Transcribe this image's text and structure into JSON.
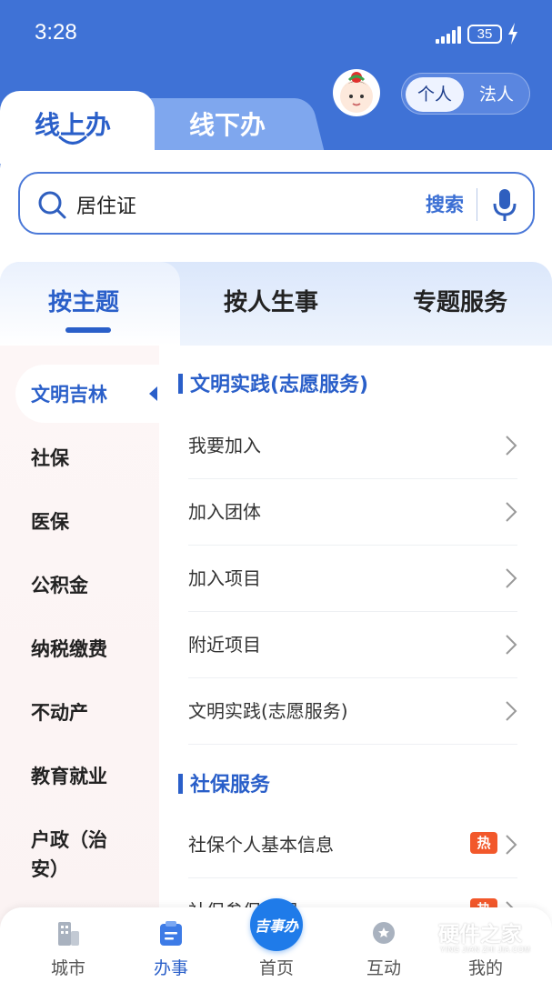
{
  "status_bar": {
    "time": "3:28",
    "battery": "35"
  },
  "header": {
    "identity_switch": {
      "selected": "个人",
      "other": "法人"
    },
    "channel_tabs": {
      "online": "线上办",
      "offline": "线下办"
    }
  },
  "search": {
    "value": "居住证",
    "button": "搜索"
  },
  "category_tabs": [
    "按主题",
    "按人生事",
    "专题服务"
  ],
  "sidebar": {
    "items": [
      {
        "label": "文明吉林"
      },
      {
        "label": "社保"
      },
      {
        "label": "医保"
      },
      {
        "label": "公积金"
      },
      {
        "label": "纳税缴费"
      },
      {
        "label": "不动产"
      },
      {
        "label": "教育就业"
      },
      {
        "label": "户政（治安）"
      }
    ]
  },
  "content": {
    "sections": [
      {
        "title": "文明实践(志愿服务)",
        "rows": [
          "我要加入",
          "加入团体",
          "加入项目",
          "附近项目",
          "文明实践(志愿服务)"
        ]
      },
      {
        "title": "社保服务",
        "rows": [
          "社保个人基本信息",
          "社保参保证明"
        ],
        "hot_badge": "热"
      }
    ]
  },
  "bottom_nav": {
    "items": [
      {
        "label": "城市"
      },
      {
        "label": "办事"
      },
      {
        "label": "首页"
      },
      {
        "label": "互动"
      },
      {
        "label": "我的"
      }
    ],
    "home_badge": "吉事办"
  },
  "watermark": {
    "title": "硬件之家",
    "subtitle": "YING JIAN ZHI JIA.COM"
  },
  "colors": {
    "primary": "#3f72d6",
    "accent": "#2a5fc9",
    "hot": "#f2582b"
  }
}
